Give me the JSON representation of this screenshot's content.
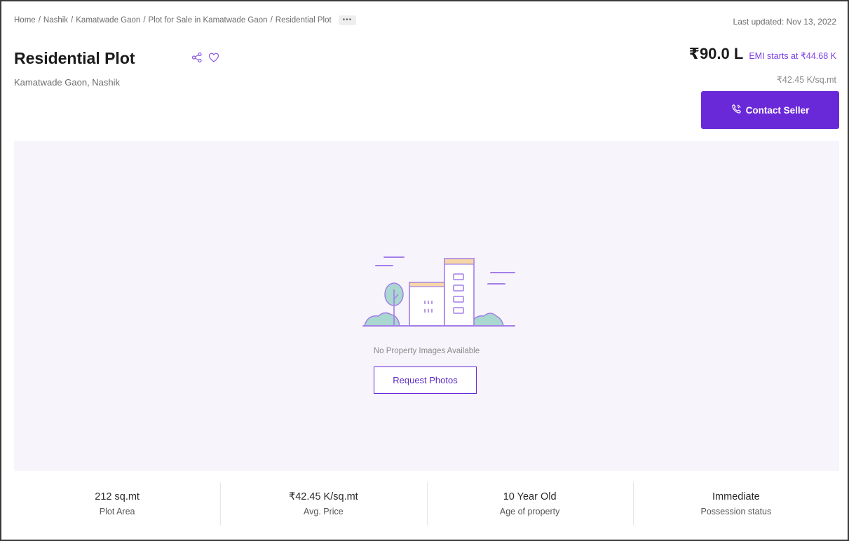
{
  "breadcrumb": {
    "items": [
      "Home",
      "Nashik",
      "Kamatwade Gaon",
      "Plot for Sale in Kamatwade Gaon",
      "Residential Plot"
    ],
    "separator": "/",
    "more_label": "•••"
  },
  "last_updated": "Last updated: Nov 13, 2022",
  "listing": {
    "title": "Residential Plot",
    "location": "Kamatwade Gaon, Nashik",
    "price": "₹90.0 L",
    "emi": "EMI starts at ₹44.68 K",
    "price_per_unit": "₹42.45 K/sq.mt",
    "contact_label": "Contact Seller"
  },
  "gallery": {
    "empty_text": "No Property Images Available",
    "request_label": "Request Photos"
  },
  "stats": [
    {
      "value": "212 sq.mt",
      "label": "Plot Area"
    },
    {
      "value": "₹42.45 K/sq.mt",
      "label": "Avg. Price"
    },
    {
      "value": "10 Year Old",
      "label": "Age of property"
    },
    {
      "value": "Immediate",
      "label": "Possession status"
    }
  ],
  "colors": {
    "accent": "#6a29d8",
    "gallery_bg": "#f7f5fb",
    "illustration_stroke": "#a47ee8",
    "illustration_green": "#a8d8cf",
    "illustration_yellow": "#f6d7a7"
  },
  "icons": [
    "share-icon",
    "heart-icon",
    "phone-icon",
    "building-illustration"
  ]
}
